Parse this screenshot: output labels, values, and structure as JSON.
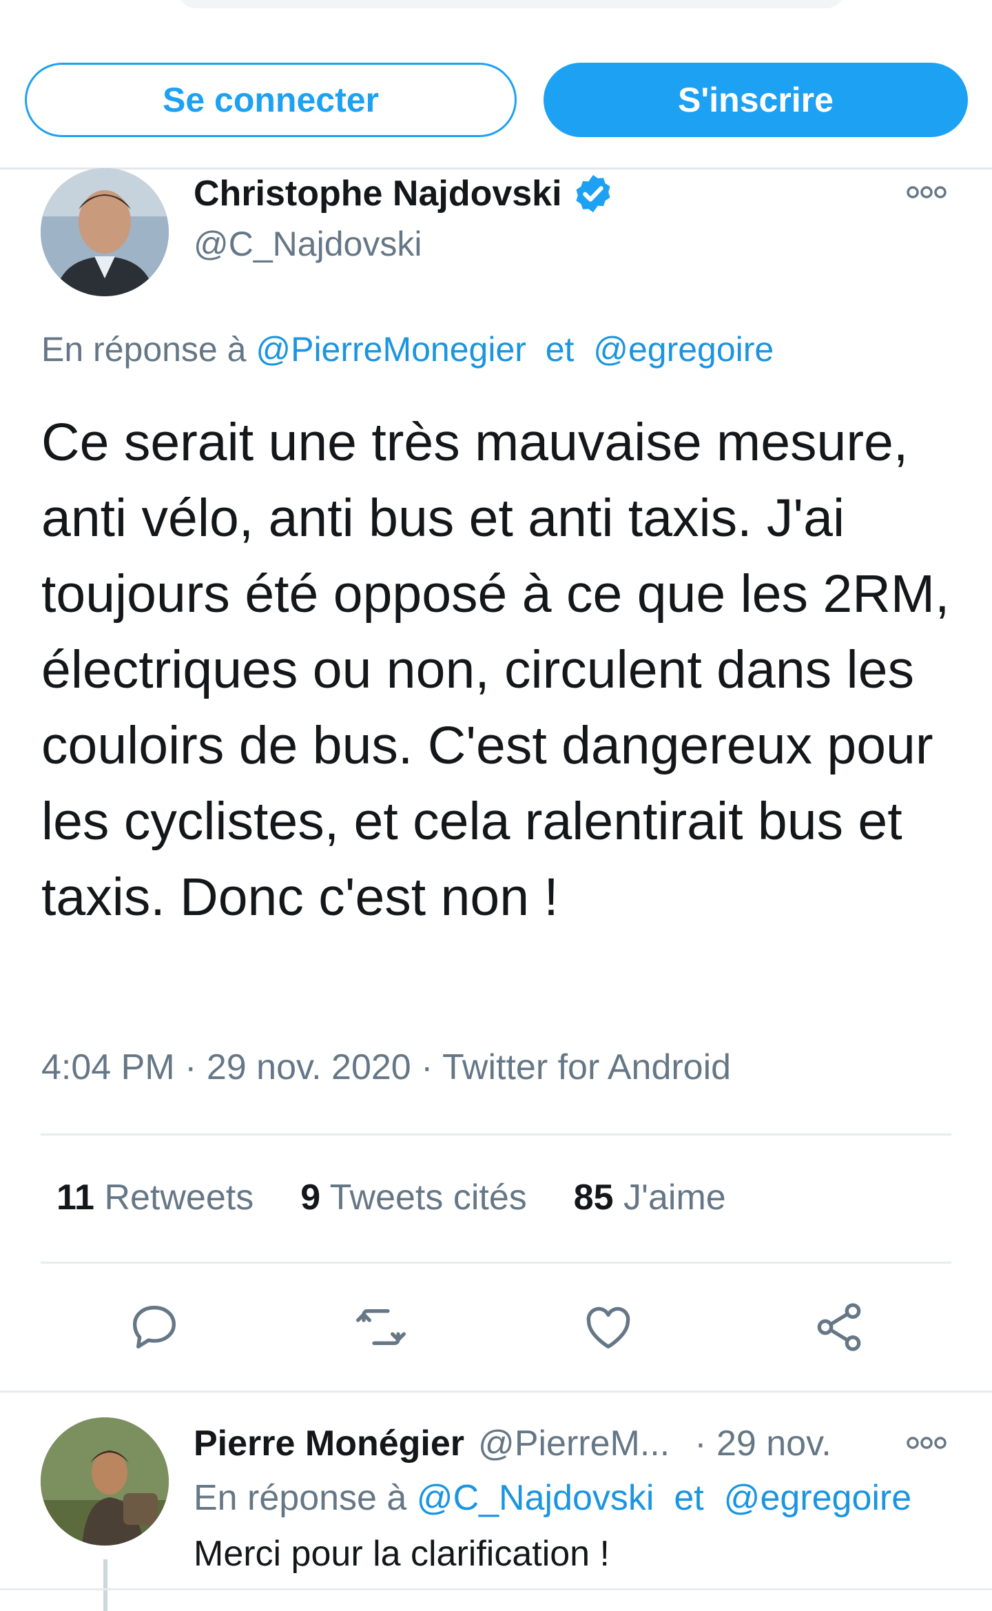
{
  "auth": {
    "login_label": "Se connecter",
    "signup_label": "S'inscrire"
  },
  "tweet": {
    "author_name": "Christophe Najdovski",
    "author_handle": "@C_Najdovski",
    "verified": true,
    "reply_prefix": "En réponse à",
    "reply_to_1": "@PierreMonegier",
    "reply_joiner": "et",
    "reply_to_2": "@egregoire",
    "text": "Ce serait une très mauvaise mesure, anti vélo, anti bus et anti taxis. J'ai toujours été opposé à ce que les 2RM, électriques ou non, circulent dans les couloirs de bus. C'est dangereux pour les cyclistes, et cela ralentirait bus et taxis. Donc c'est non !",
    "time": "4:04 PM",
    "date": "29 nov. 2020",
    "source": "Twitter for Android",
    "retweets_count": "11",
    "retweets_label": "Retweets",
    "quotes_count": "9",
    "quotes_label": "Tweets cités",
    "likes_count": "85",
    "likes_label": "J'aime"
  },
  "actions": {
    "icons": [
      "reply-icon",
      "retweet-icon",
      "like-icon",
      "share-icon"
    ]
  },
  "reply": {
    "author_name": "Pierre Monégier",
    "author_handle": "@PierreM...",
    "date": "29 nov.",
    "reply_prefix": "En réponse à",
    "reply_to_1": "@C_Najdovski",
    "reply_joiner": "et",
    "reply_to_2": "@egregoire",
    "text": "Merci pour la clarification !"
  },
  "colors": {
    "accent": "#1da1f2",
    "secondary_text": "#657786",
    "primary_text": "#14171a"
  }
}
